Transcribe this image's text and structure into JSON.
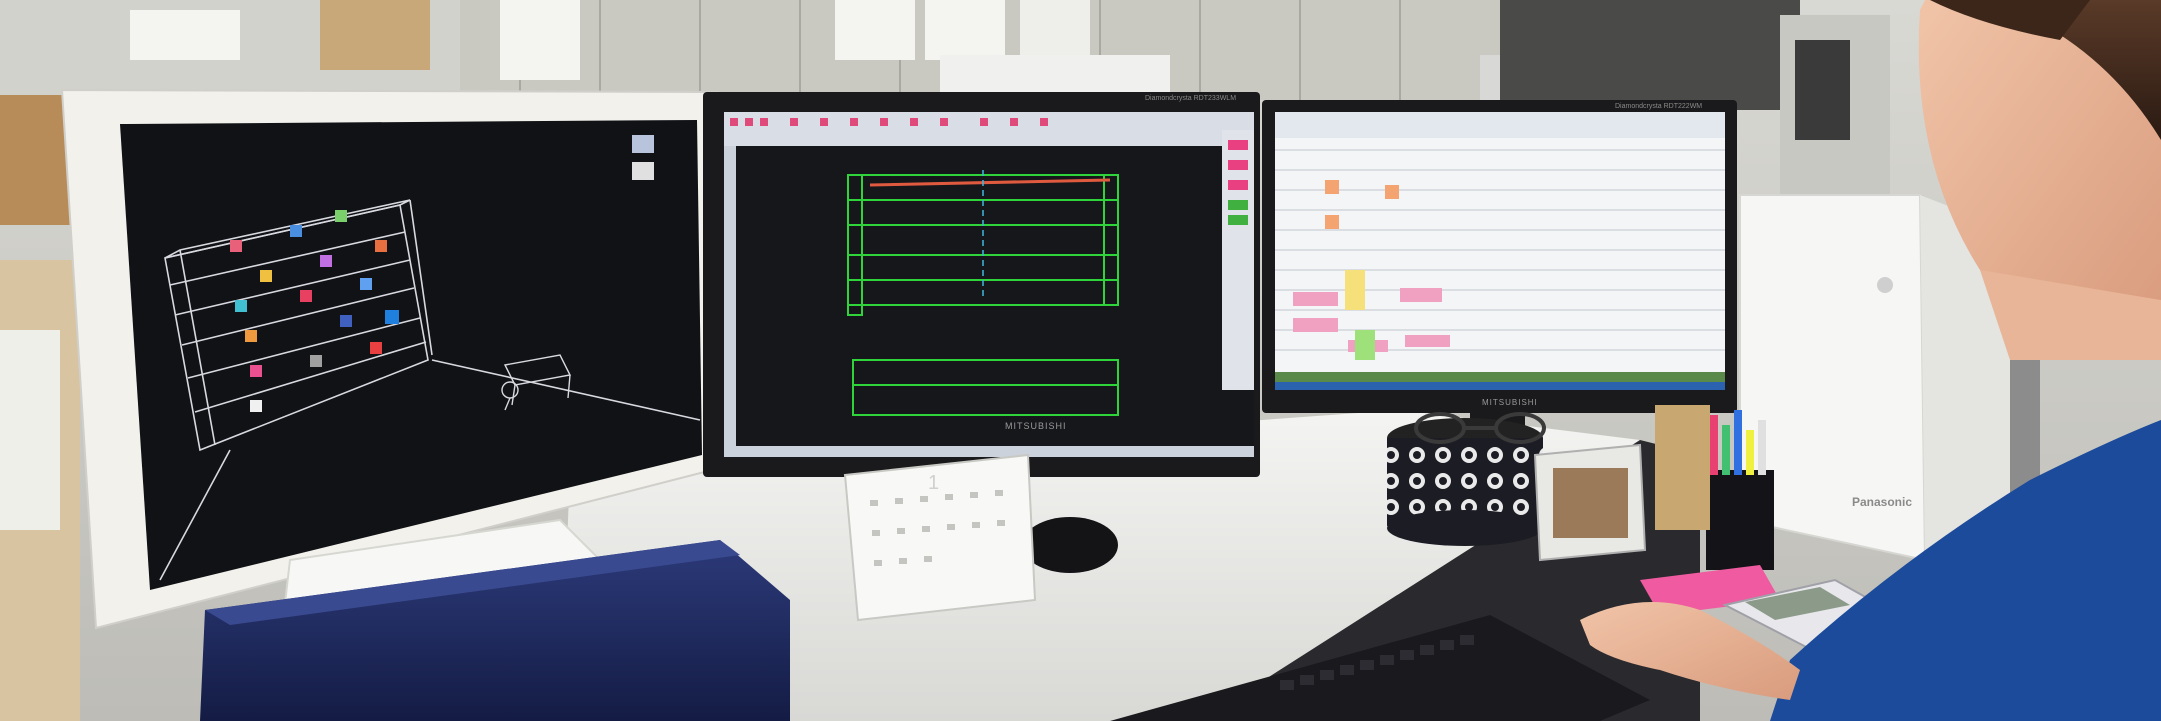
{
  "monitor_left": {
    "desktop_icons": [
      "",
      ""
    ]
  },
  "monitor_center": {
    "brand": "MITSUBISHI",
    "model": "Diamondcrysta RDT233WLM"
  },
  "monitor_right": {
    "brand": "MITSUBISHI",
    "model": "Diamondcrysta RDT222WM"
  },
  "desk": {
    "calendar_month": "1",
    "printer_brand": "Panasonic"
  },
  "colors": {
    "monitor_bezel_white": "#f2f1ec",
    "monitor_bezel_black": "#1a1a1c",
    "cad_background": "#15171b",
    "cad_lines_green": "#2fd33a",
    "spreadsheet_pink": "#f0a0c0",
    "shirt_blue": "#1b4b9a",
    "desk_white": "#ececea"
  }
}
